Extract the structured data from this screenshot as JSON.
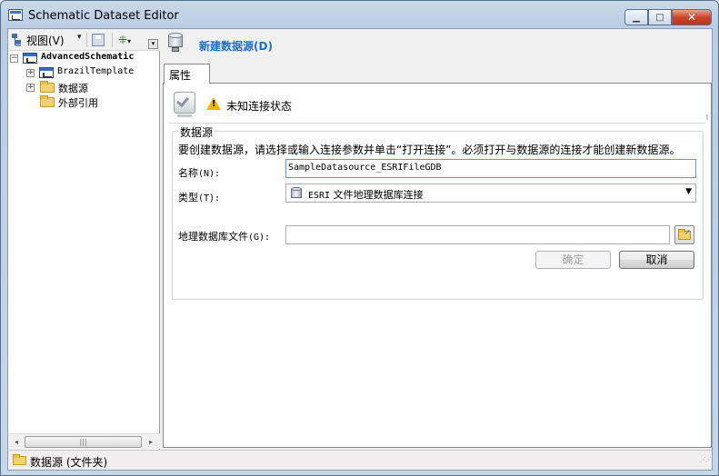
{
  "window": {
    "title": "Schematic Dataset Editor",
    "minimize_glyph": "▁",
    "maximize_glyph": "□",
    "close_glyph": "✕"
  },
  "toolbar": {
    "view_label": "视图(V)",
    "view_caret": "▾",
    "layout_caret": "▾",
    "more_glyph": "▾"
  },
  "tree": {
    "root": {
      "label": "AdvancedSchematic",
      "expander": "−"
    },
    "items": [
      {
        "label": "BrazilTemplate",
        "expander": "+"
      },
      {
        "label": "数据源",
        "expander": "+"
      },
      {
        "label": "外部引用",
        "expander": ""
      }
    ]
  },
  "hscroll": {
    "left": "◂",
    "right": "▸",
    "thumb": "|||"
  },
  "header": {
    "title": "新建数据源(D)"
  },
  "tabs": [
    {
      "label": "属性"
    }
  ],
  "status": {
    "text": "未知连接状态"
  },
  "datasource": {
    "group_title": "数据源",
    "description": "要创建数据源，请选择或输入连接参数并单击“打开连接”。必须打开与数据源的连接才能创建新数据源。",
    "name_label": "名称",
    "name_hotkey": "(N):",
    "name_value": "SampleDatasource_ESRIFileGDB",
    "type_label": "类型",
    "type_hotkey": "(T):",
    "type_value_prefix": "ESRI",
    "type_value": "文件地理数据库连接",
    "type_caret": "▼",
    "gdb_label": "地理数据库文件",
    "gdb_hotkey": "(G):",
    "gdb_value": "",
    "ok_label": "确定",
    "cancel_label": "取消"
  },
  "statusbar": {
    "text": "数据源 (文件夹)"
  }
}
